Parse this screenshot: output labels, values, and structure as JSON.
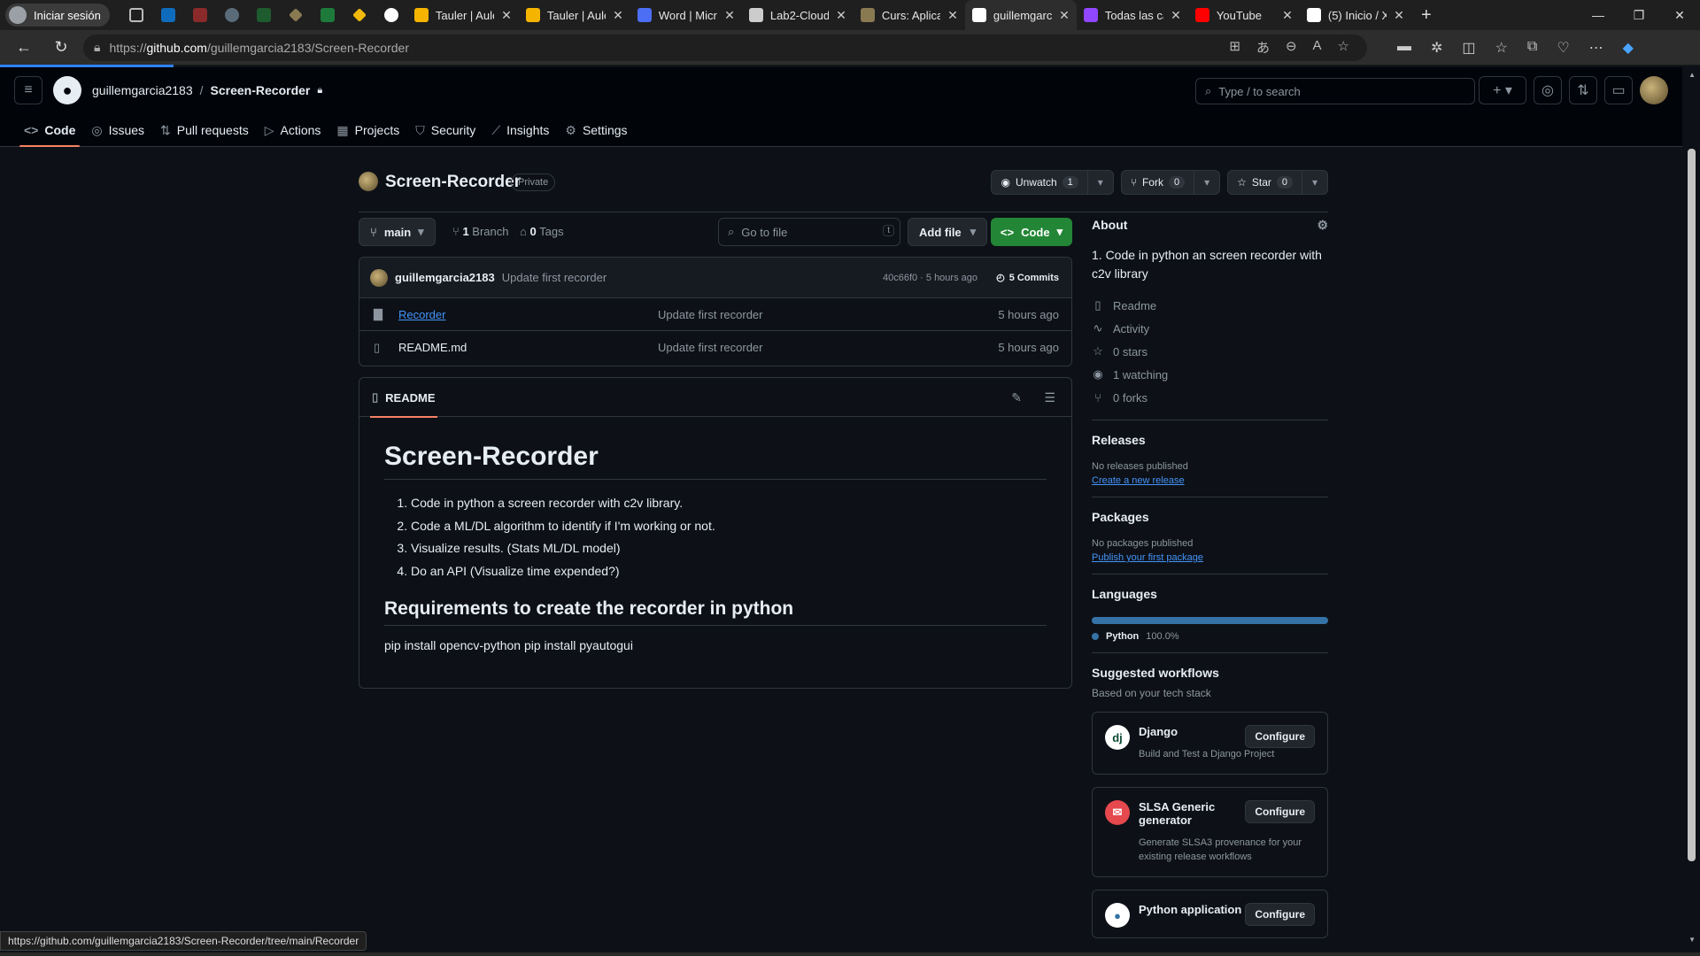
{
  "browser": {
    "profile_label": "Iniciar sesión",
    "tabs": [
      {
        "label": "Tauler | Aule",
        "color": "#f5b400"
      },
      {
        "label": "Tauler | Aule",
        "color": "#f5b400"
      },
      {
        "label": "Word | Micro",
        "color": "#4c6ef5"
      },
      {
        "label": "Lab2-Cloud",
        "color": "#cccccc"
      },
      {
        "label": "Curs: Aplicac",
        "color": "#8a7a52"
      },
      {
        "label": "guillemgarcia",
        "color": "#ffffff"
      },
      {
        "label": "Todas las ca",
        "color": "#9146ff"
      },
      {
        "label": "YouTube",
        "color": "#ff0000"
      },
      {
        "label": "(5) Inicio / X",
        "color": "#ffffff"
      }
    ],
    "url_prefix": "https://",
    "url_domain": "github.com",
    "url_path": "/guillemgarcia2183/Screen-Recorder"
  },
  "header": {
    "owner": "guillemgarcia2183",
    "repo": "Screen-Recorder",
    "search_placeholder": "Type / to search"
  },
  "reponav": [
    {
      "label": "Code",
      "icon": "<>"
    },
    {
      "label": "Issues",
      "icon": "◎"
    },
    {
      "label": "Pull requests",
      "icon": "⇅"
    },
    {
      "label": "Actions",
      "icon": "▷"
    },
    {
      "label": "Projects",
      "icon": "▦"
    },
    {
      "label": "Security",
      "icon": "⛉"
    },
    {
      "label": "Insights",
      "icon": "⟋"
    },
    {
      "label": "Settings",
      "icon": "⚙"
    }
  ],
  "repo": {
    "name": "Screen-Recorder",
    "visibility": "Private",
    "watch_label": "Unwatch",
    "watch_count": "1",
    "fork_label": "Fork",
    "fork_count": "0",
    "star_label": "Star",
    "star_count": "0"
  },
  "bar": {
    "branch": "main",
    "branches": "1",
    "branches_label": "Branch",
    "tags": "0",
    "tags_label": "Tags",
    "gofile_placeholder": "Go to file",
    "gofile_key": "t",
    "add_file": "Add file",
    "code": "Code"
  },
  "commit": {
    "user": "guillemgarcia2183",
    "message": "Update first recorder",
    "hash": "40c66f0 · 5 hours ago",
    "count": "5 Commits"
  },
  "files": [
    {
      "name": "Recorder",
      "type": "folder",
      "message": "Update first recorder",
      "age": "5 hours ago"
    },
    {
      "name": "README.md",
      "type": "file",
      "message": "Update first recorder",
      "age": "5 hours ago"
    }
  ],
  "readme": {
    "tab": "README",
    "title": "Screen-Recorder",
    "items": [
      "Code in python a screen recorder with c2v library.",
      "Code a ML/DL algorithm to identify if I'm working or not.",
      "Visualize results. (Stats ML/DL model)",
      "Do an API (Visualize time expended?)"
    ],
    "h2": "Requirements to create the recorder in python",
    "p": "pip install opencv-python pip install pyautogui"
  },
  "about": {
    "heading": "About",
    "desc": "1. Code in python an screen recorder with c2v library",
    "links": [
      {
        "icon": "▯",
        "label": "Readme"
      },
      {
        "icon": "∿",
        "label": "Activity"
      },
      {
        "icon": "☆",
        "label": "0 stars"
      },
      {
        "icon": "◉",
        "label": "1 watching"
      },
      {
        "icon": "⑂",
        "label": "0 forks"
      }
    ]
  },
  "releases": {
    "heading": "Releases",
    "empty": "No releases published",
    "link": "Create a new release"
  },
  "packages": {
    "heading": "Packages",
    "empty": "No packages published",
    "link": "Publish your first package"
  },
  "languages": {
    "heading": "Languages",
    "name": "Python",
    "percent": "100.0%",
    "fraction": 1.0,
    "color": "#3572A5"
  },
  "workflows": {
    "heading": "Suggested workflows",
    "sub": "Based on your tech stack",
    "items": [
      {
        "title": "Django",
        "desc": "Build and Test a Django Project",
        "button": "Configure",
        "icon": "dj",
        "icon_bg": "#ffffff",
        "icon_fg": "#0c4b33"
      },
      {
        "title": "SLSA Generic generator",
        "desc": "Generate SLSA3 provenance for your existing release workflows",
        "button": "Configure",
        "icon": "✉",
        "icon_bg": "#e5484d",
        "icon_fg": "#ffffff"
      },
      {
        "title": "Python application",
        "desc": "",
        "button": "Configure",
        "icon": "●",
        "icon_bg": "#ffffff",
        "icon_fg": "#3572A5"
      }
    ]
  },
  "status_url": "https://github.com/guillemgarcia2183/Screen-Recorder/tree/main/Recorder"
}
